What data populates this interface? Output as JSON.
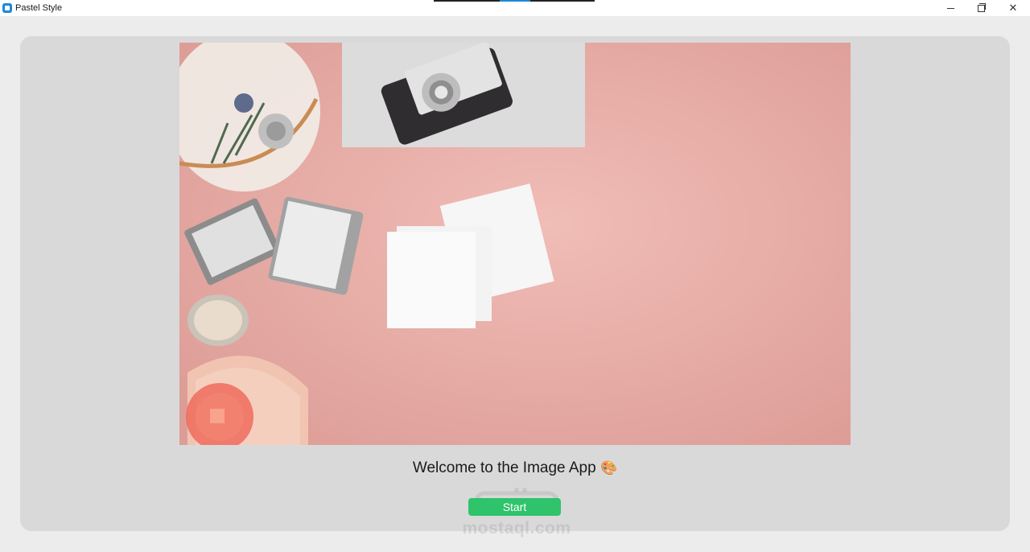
{
  "window": {
    "title": "Pastel Style"
  },
  "main": {
    "welcome_text": "Welcome to the Image App",
    "welcome_icon": "🎨",
    "start_label": "Start"
  },
  "watermark": {
    "text": "mostaql.com"
  },
  "colors": {
    "accent": "#2fc36b",
    "card_bg": "#d9d9d9",
    "window_bg": "#ececec",
    "app_icon": "#1e88d8"
  },
  "icons": {
    "app": "app-icon",
    "minimize": "minimize-icon",
    "maximize": "restore-icon",
    "close": "close-icon",
    "palette": "palette-icon"
  }
}
